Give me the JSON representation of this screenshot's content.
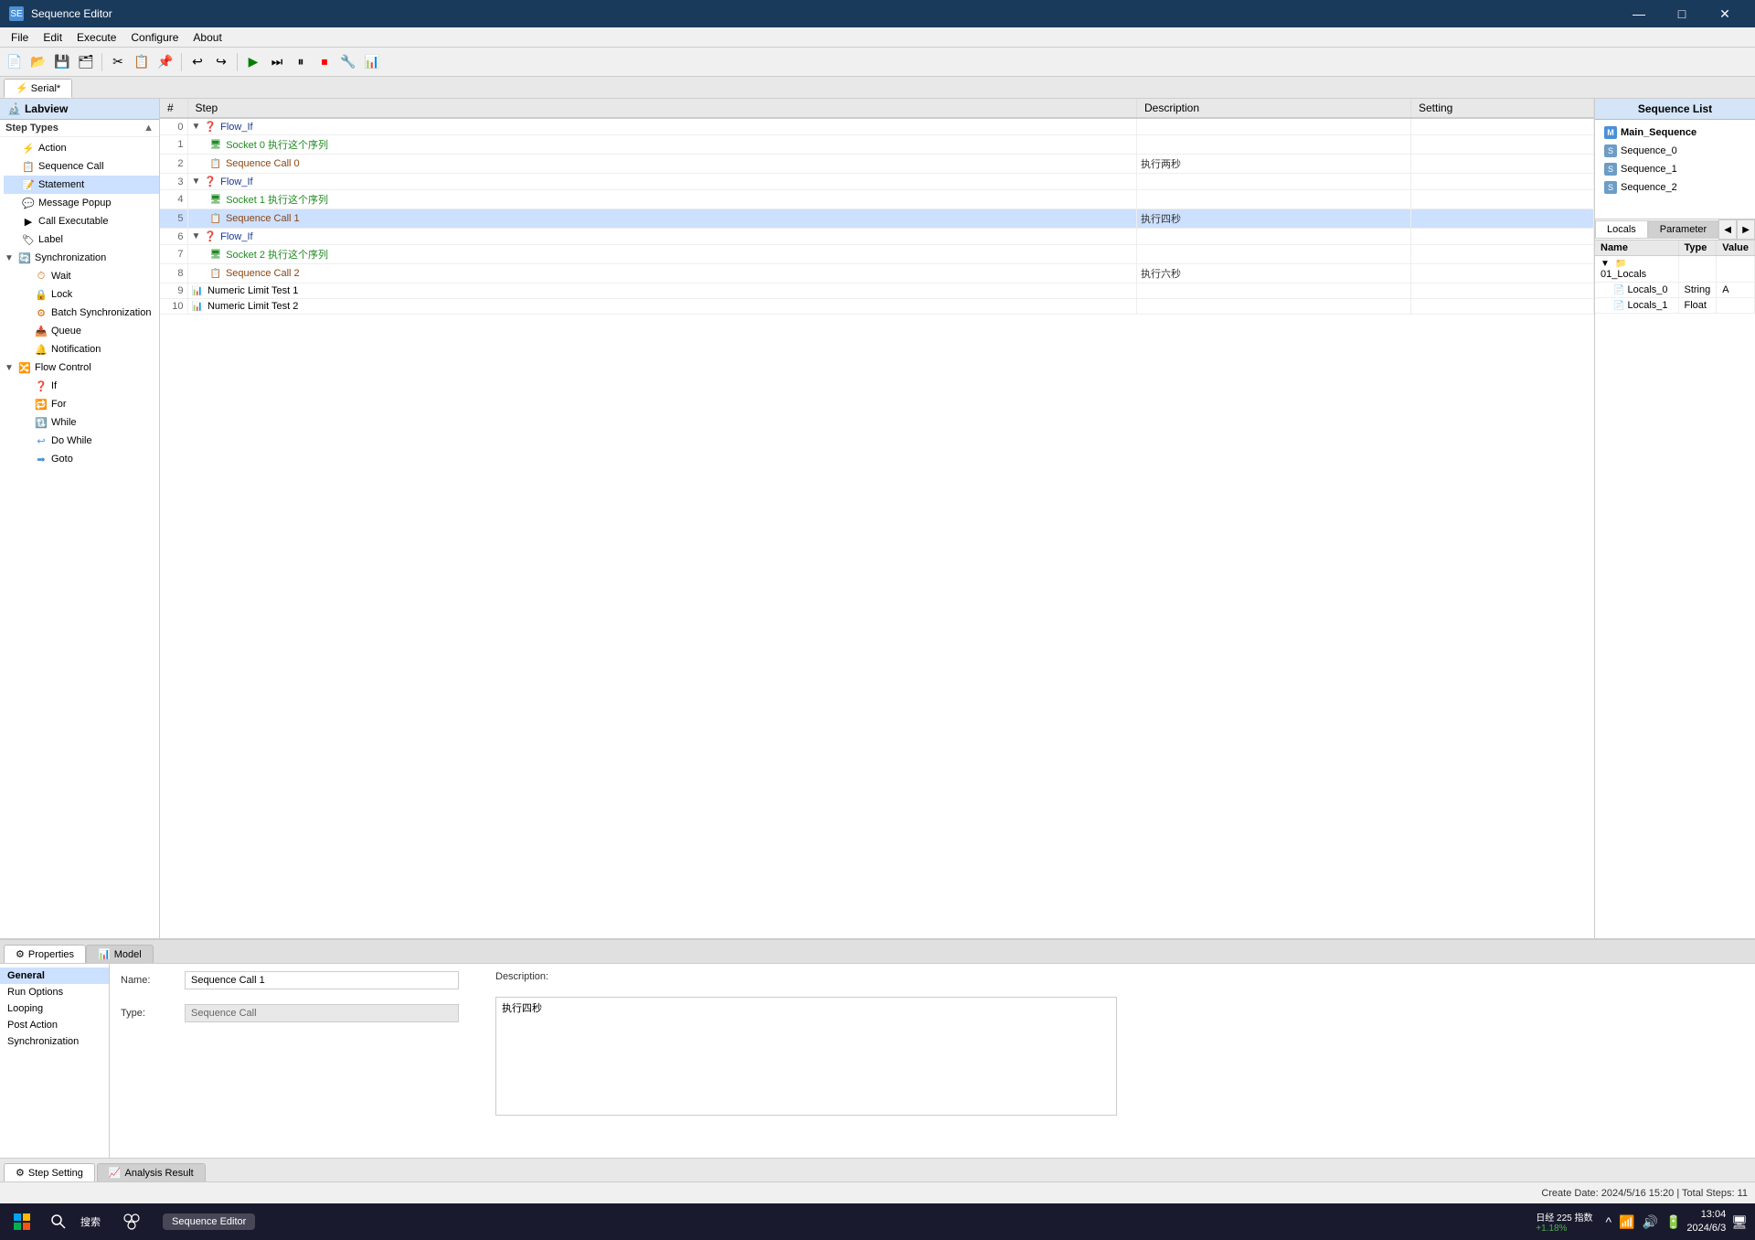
{
  "window": {
    "title": "Sequence Editor",
    "icon": "SE"
  },
  "menubar": {
    "items": [
      "File",
      "Edit",
      "Execute",
      "Configure",
      "About"
    ]
  },
  "toolbar": {
    "buttons": [
      "new",
      "open",
      "save",
      "save-all",
      "undo",
      "redo",
      "run",
      "step-over",
      "step-into",
      "step-out",
      "break",
      "stop"
    ]
  },
  "tab": {
    "label": "Serial*"
  },
  "left_panel": {
    "header": "Labview",
    "section_label": "Step Types",
    "items": [
      {
        "label": "Action",
        "indent": 1,
        "has_expand": false,
        "icon": "⚡"
      },
      {
        "label": "Sequence Call",
        "indent": 1,
        "has_expand": false,
        "icon": "📋"
      },
      {
        "label": "Statement",
        "indent": 1,
        "has_expand": false,
        "icon": "📝",
        "selected": true
      },
      {
        "label": "Message Popup",
        "indent": 1,
        "has_expand": false,
        "icon": "💬"
      },
      {
        "label": "Call Executable",
        "indent": 1,
        "has_expand": false,
        "icon": "▶"
      },
      {
        "label": "Label",
        "indent": 1,
        "has_expand": false,
        "icon": "🏷"
      },
      {
        "label": "Synchronization",
        "indent": 0,
        "has_expand": true,
        "expanded": true,
        "icon": "🔄"
      },
      {
        "label": "Wait",
        "indent": 2,
        "has_expand": false,
        "icon": "⏱"
      },
      {
        "label": "Lock",
        "indent": 2,
        "has_expand": false,
        "icon": "🔒"
      },
      {
        "label": "Batch Synchronization",
        "indent": 2,
        "has_expand": false,
        "icon": "⚙"
      },
      {
        "label": "Queue",
        "indent": 2,
        "has_expand": false,
        "icon": "📥"
      },
      {
        "label": "Notification",
        "indent": 2,
        "has_expand": false,
        "icon": "🔔"
      },
      {
        "label": "Flow Control",
        "indent": 0,
        "has_expand": true,
        "expanded": true,
        "icon": "🔀"
      },
      {
        "label": "If",
        "indent": 2,
        "has_expand": false,
        "icon": "❓"
      },
      {
        "label": "For",
        "indent": 2,
        "has_expand": false,
        "icon": "🔁"
      },
      {
        "label": "While",
        "indent": 2,
        "has_expand": false,
        "icon": "🔃"
      },
      {
        "label": "Do While",
        "indent": 2,
        "has_expand": false,
        "icon": "↩"
      },
      {
        "label": "Goto",
        "indent": 2,
        "has_expand": false,
        "icon": "➡"
      }
    ]
  },
  "sequence_table": {
    "columns": [
      "Step",
      "Description",
      "Setting"
    ],
    "rows": [
      {
        "num": "0",
        "indent": 0,
        "icon_type": "flow_if",
        "label": "Flow_If",
        "description": "",
        "setting": "",
        "expanded": true
      },
      {
        "num": "1",
        "indent": 1,
        "icon_type": "socket",
        "label": "Socket 0 执行这个序列",
        "description": "",
        "setting": ""
      },
      {
        "num": "2",
        "indent": 1,
        "icon_type": "seq_call",
        "label": "Sequence Call 0",
        "description": "执行两秒",
        "setting": ""
      },
      {
        "num": "3",
        "indent": 0,
        "icon_type": "flow_if",
        "label": "Flow_If",
        "description": "",
        "setting": "",
        "expanded": true
      },
      {
        "num": "4",
        "indent": 1,
        "icon_type": "socket",
        "label": "Socket 1 执行这个序列",
        "description": "",
        "setting": ""
      },
      {
        "num": "5",
        "indent": 1,
        "icon_type": "seq_call",
        "label": "Sequence Call 1",
        "description": "执行四秒",
        "setting": "",
        "selected": true
      },
      {
        "num": "6",
        "indent": 0,
        "icon_type": "flow_if",
        "label": "Flow_If",
        "description": "",
        "setting": "",
        "expanded": true
      },
      {
        "num": "7",
        "indent": 1,
        "icon_type": "socket",
        "label": "Socket 2 执行这个序列",
        "description": "",
        "setting": ""
      },
      {
        "num": "8",
        "indent": 1,
        "icon_type": "seq_call",
        "label": "Sequence Call 2",
        "description": "执行六秒",
        "setting": ""
      },
      {
        "num": "9",
        "indent": 0,
        "icon_type": "numeric",
        "label": "Numeric Limit Test 1",
        "description": "",
        "setting": ""
      },
      {
        "num": "10",
        "indent": 0,
        "icon_type": "numeric",
        "label": "Numeric Limit Test 2",
        "description": "",
        "setting": ""
      }
    ]
  },
  "right_panel": {
    "header": "Sequence List",
    "items": [
      {
        "label": "Main_Sequence",
        "is_main": true
      },
      {
        "label": "Sequence_0"
      },
      {
        "label": "Sequence_1"
      },
      {
        "label": "Sequence_2"
      }
    ]
  },
  "locals_panel": {
    "tabs": [
      "Locals",
      "Parameter"
    ],
    "active_tab": "Locals",
    "columns": [
      "Name",
      "Type",
      "Value"
    ],
    "rows": [
      {
        "name": "01_Locals",
        "type": "",
        "value": "",
        "is_group": true
      },
      {
        "name": "Locals_0",
        "type": "String",
        "value": "A",
        "indent": 1
      },
      {
        "name": "Locals_1",
        "type": "Float",
        "value": "",
        "indent": 1
      }
    ]
  },
  "properties_panel": {
    "tabs": [
      {
        "label": "Properties",
        "icon": "⚙"
      },
      {
        "label": "Model",
        "icon": "📊"
      }
    ],
    "active_tab": "Properties",
    "sections": [
      "General",
      "Run Options",
      "Looping",
      "Post Action",
      "Synchronization"
    ],
    "active_section": "General",
    "fields": {
      "name_label": "Name:",
      "name_value": "Sequence Call 1",
      "type_label": "Type:",
      "type_value": "Sequence Call",
      "description_label": "Description:",
      "description_value": "执行四秒"
    }
  },
  "bottom_tabs": [
    {
      "label": "Step Setting",
      "icon": "⚙"
    },
    {
      "label": "Analysis Result",
      "icon": "📈"
    }
  ],
  "active_bottom_tab": "Step Setting",
  "status_bar": {
    "left": "Create Date: 2024/5/16 15:20  |  Total Steps: 11",
    "stock_info": "日经 225 指数",
    "stock_value": "+1.18%"
  },
  "taskbar": {
    "clock_time": "13:04",
    "clock_date": "2024/6/3"
  }
}
